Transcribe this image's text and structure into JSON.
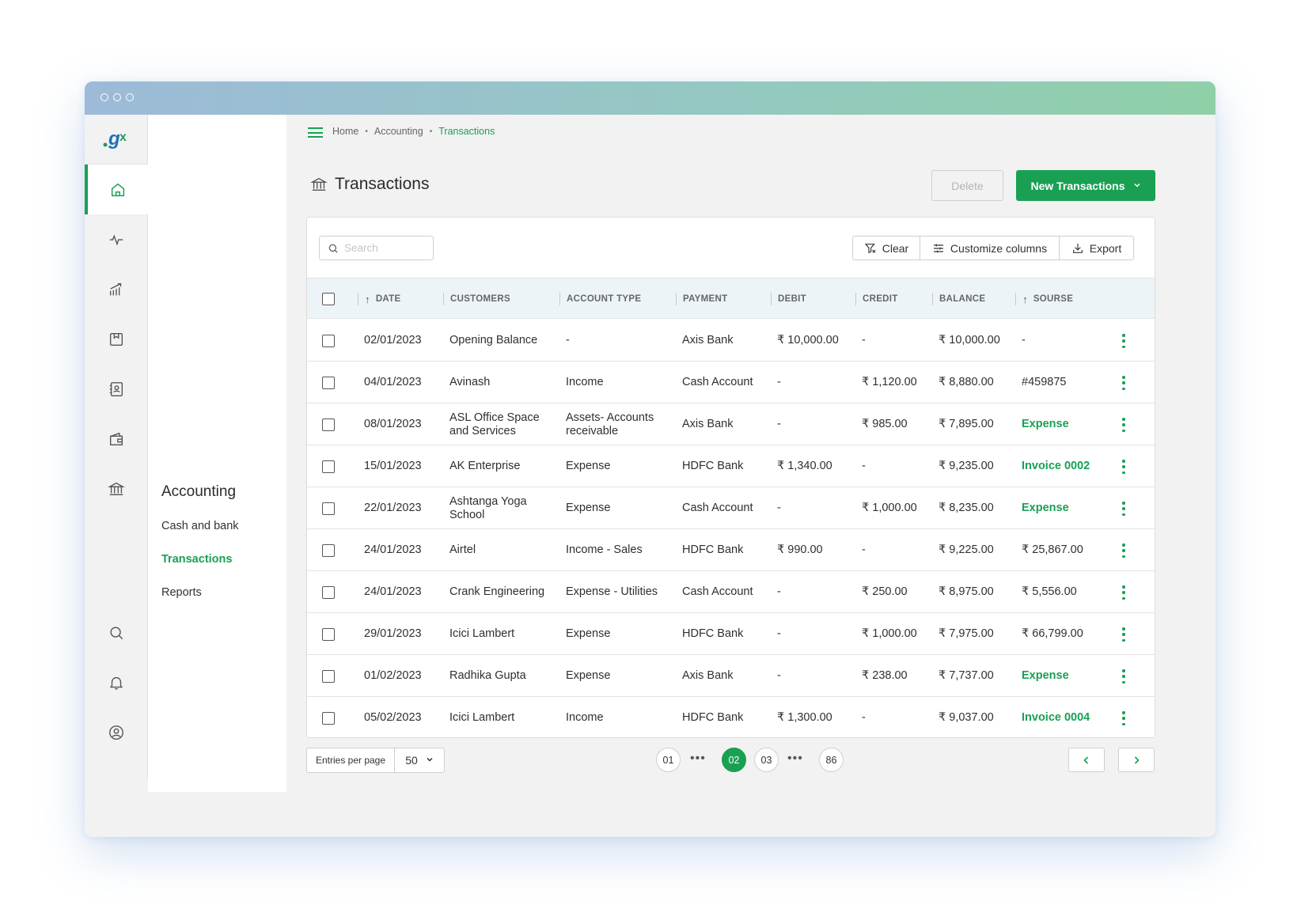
{
  "app": {
    "logo_text": ".gx",
    "brand_color": "#1aa053"
  },
  "rail": {
    "items": [
      "home-icon",
      "activity-icon",
      "chart-icon",
      "inventory-icon",
      "contacts-icon",
      "wallet-icon",
      "bank-icon",
      "search-icon",
      "bell-icon",
      "user-icon"
    ]
  },
  "subnav": {
    "title": "Accounting",
    "items": [
      {
        "label": "Cash and bank"
      },
      {
        "label": "Transactions"
      },
      {
        "label": "Reports"
      }
    ]
  },
  "breadcrumb": {
    "home": "Home",
    "section": "Accounting",
    "current": "Transactions"
  },
  "page": {
    "title": "Transactions"
  },
  "actions": {
    "delete": "Delete",
    "new": "New Transactions"
  },
  "toolbar": {
    "search_placeholder": "Search",
    "clear": "Clear",
    "customize": "Customize columns",
    "export": "Export"
  },
  "table": {
    "columns": [
      "DATE",
      "CUSTOMERS",
      "ACCOUNT TYPE",
      "PAYMENT",
      "DEBIT",
      "CREDIT",
      "BALANCE",
      "SOURSE"
    ],
    "rows": [
      {
        "date": "02/01/2023",
        "customer": "Opening Balance",
        "account": "-",
        "payment": "Axis Bank",
        "debit": "₹ 10,000.00",
        "credit": "-",
        "balance": "₹ 10,000.00",
        "source": "-",
        "source_green": false
      },
      {
        "date": "04/01/2023",
        "customer": "Avinash",
        "account": "Income",
        "payment": "Cash Account",
        "debit": "-",
        "credit": "₹ 1,120.00",
        "balance": "₹ 8,880.00",
        "source": "#459875",
        "source_green": false
      },
      {
        "date": "08/01/2023",
        "customer": "ASL Office Space and Services",
        "account": "Assets- Accounts receivable",
        "payment": "Axis Bank",
        "debit": "-",
        "credit": "₹ 985.00",
        "balance": "₹ 7,895.00",
        "source": "Expense",
        "source_green": true
      },
      {
        "date": "15/01/2023",
        "customer": "AK Enterprise",
        "account": "Expense",
        "payment": "HDFC Bank",
        "debit": "₹ 1,340.00",
        "credit": "-",
        "balance": "₹ 9,235.00",
        "source": "Invoice 0002",
        "source_green": true
      },
      {
        "date": "22/01/2023",
        "customer": "Ashtanga Yoga School",
        "account": "Expense",
        "payment": "Cash Account",
        "debit": "-",
        "credit": "₹ 1,000.00",
        "balance": "₹ 8,235.00",
        "source": "Expense",
        "source_green": true
      },
      {
        "date": "24/01/2023",
        "customer": "Airtel",
        "account": "Income - Sales",
        "payment": "HDFC Bank",
        "debit": "₹ 990.00",
        "credit": "-",
        "balance": "₹ 9,225.00",
        "source": "₹ 25,867.00",
        "source_green": false
      },
      {
        "date": "24/01/2023",
        "customer": "Crank Engineering",
        "account": "Expense - Utilities",
        "payment": "Cash Account",
        "debit": "-",
        "credit": "₹ 250.00",
        "balance": "₹ 8,975.00",
        "source": "₹ 5,556.00",
        "source_green": false
      },
      {
        "date": "29/01/2023",
        "customer": "Icici Lambert",
        "account": "Expense",
        "payment": "HDFC Bank",
        "debit": "-",
        "credit": "₹ 1,000.00",
        "balance": "₹ 7,975.00",
        "source": "₹ 66,799.00",
        "source_green": false
      },
      {
        "date": "01/02/2023",
        "customer": "Radhika Gupta",
        "account": "Expense",
        "payment": "Axis Bank",
        "debit": "-",
        "credit": "₹ 238.00",
        "balance": "₹ 7,737.00",
        "source": "Expense",
        "source_green": true
      },
      {
        "date": "05/02/2023",
        "customer": "Icici Lambert",
        "account": "Income",
        "payment": "HDFC Bank",
        "debit": "₹ 1,300.00",
        "credit": "-",
        "balance": "₹ 9,037.00",
        "source": "Invoice 0004",
        "source_green": true
      }
    ]
  },
  "pagination": {
    "entries_label": "Entries per page",
    "entries_value": "50",
    "pages": [
      "01",
      "02",
      "03",
      "86"
    ],
    "current": "02"
  }
}
